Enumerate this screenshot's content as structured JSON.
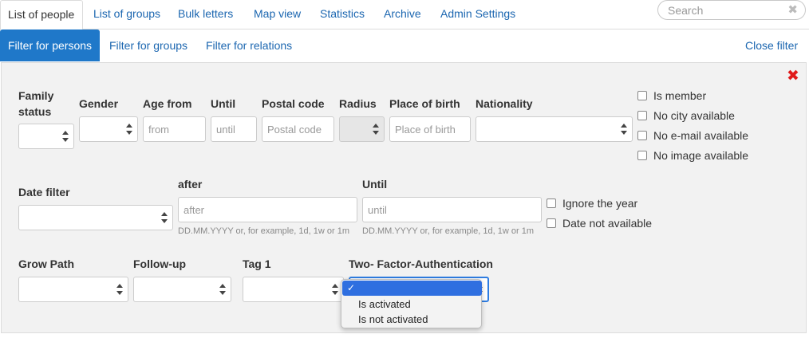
{
  "topnav": {
    "tabs": [
      {
        "label": "List of people",
        "active": true
      },
      {
        "label": "List of groups"
      },
      {
        "label": "Bulk letters"
      },
      {
        "label": "Map view"
      },
      {
        "label": "Statistics"
      },
      {
        "label": "Archive"
      },
      {
        "label": "Admin Settings"
      }
    ],
    "search_placeholder": "Search",
    "search_clear": "✖"
  },
  "subnav": {
    "tabs": [
      {
        "label": "Filter for persons",
        "active": true
      },
      {
        "label": "Filter for groups"
      },
      {
        "label": "Filter for relations"
      }
    ],
    "close_filter": "Close filter"
  },
  "filter": {
    "close_icon": "✖",
    "family_status_label": "Family\nstatus",
    "gender_label": "Gender",
    "age_from_label": "Age from",
    "age_from_placeholder": "from",
    "until_label": "Until",
    "until_placeholder": "until",
    "postal_code_label": "Postal code",
    "postal_code_placeholder": "Postal code",
    "radius_label": "Radius",
    "place_of_birth_label": "Place of birth",
    "place_of_birth_placeholder": "Place of birth",
    "nationality_label": "Nationality",
    "checkboxes_right": [
      "Is member",
      "No city available",
      "No e-mail available",
      "No image available"
    ],
    "date_filter_label": "Date filter",
    "after_label": "after",
    "after_placeholder": "after",
    "date_until_label": "Until",
    "date_until_placeholder": "until",
    "date_hint": "DD.MM.YYYY or, for example, 1d, 1w or 1m",
    "checkboxes_date": [
      "Ignore the year",
      "Date not available"
    ],
    "grow_path_label": "Grow Path",
    "follow_up_label": "Follow-up",
    "tag1_label": "Tag 1",
    "tfa_label": "Two- Factor-Authentication",
    "tfa_options": [
      "",
      "Is activated",
      "Is not activated"
    ],
    "tfa_checkmark": "✓"
  }
}
